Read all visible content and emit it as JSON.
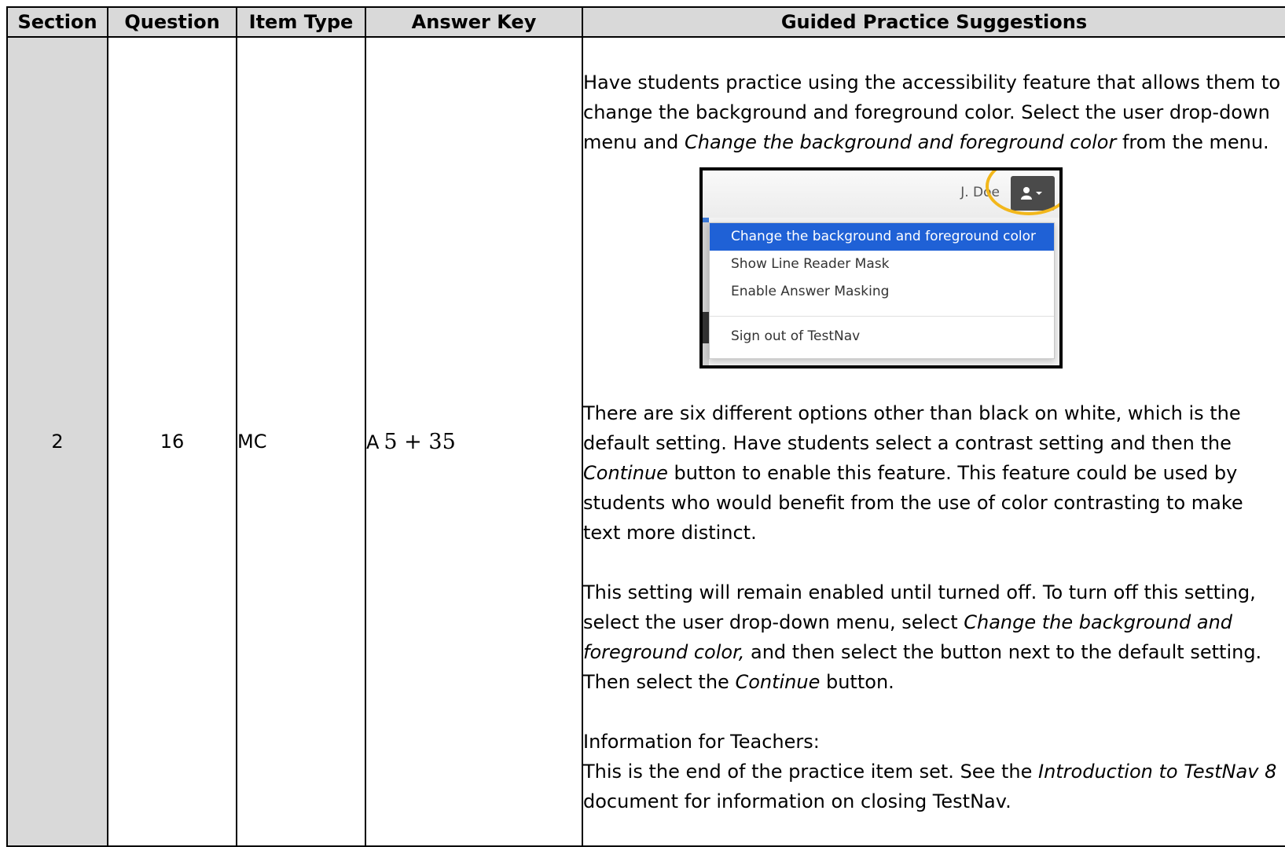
{
  "table": {
    "headers": {
      "section": "Section",
      "question": "Question",
      "item_type": "Item Type",
      "answer_key": "Answer Key",
      "guided": "Guided Practice Suggestions"
    },
    "row": {
      "section": "2",
      "question": "16",
      "item_type": "MC",
      "answer_letter": "A",
      "answer_math": "5 + 35"
    }
  },
  "guided": {
    "p1_a": "Have students practice using the accessibility feature that allows them to change the background and foreground color. Select the user drop-down menu and ",
    "p1_em": "Change the background and foreground color",
    "p1_b": " from the menu.",
    "p2_a": "There are six different options other than black on white, which is the default setting.  Have students select a contrast setting and then the ",
    "p2_em": "Continue",
    "p2_b": " button to enable this feature. This feature could be used by students who would benefit from the use of color contrasting to make text more distinct.",
    "p3_a": "This setting will remain enabled until turned off. To turn off this setting, select the user drop-down menu, select ",
    "p3_em1": "Change the background and foreground color,",
    "p3_b": " and then select the button next to the default setting. Then select the ",
    "p3_em2": "Continue",
    "p3_c": " button.",
    "info_heading": "Information for Teachers:",
    "p4_a": "This is the end of the practice item set.  See the ",
    "p4_em": "Introduction to TestNav 8",
    "p4_b": " document for information on closing TestNav."
  },
  "screenshot": {
    "user_name": "J. Doe",
    "user_icon": "user-icon",
    "caret_icon": "caret-down-icon",
    "highlight_color": "#f2b71b",
    "active_color": "#1f61d6",
    "menu_items": [
      "Change the background and foreground color",
      "Show Line Reader Mask",
      "Enable Answer Masking"
    ],
    "signout": "Sign out of TestNav"
  }
}
